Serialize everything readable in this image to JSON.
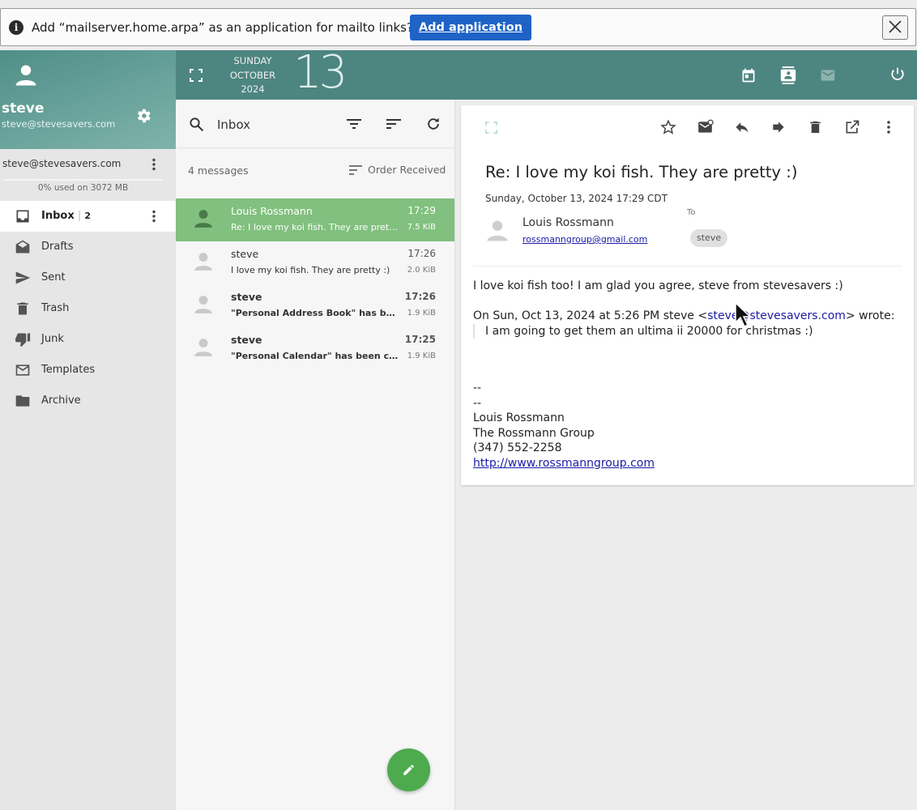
{
  "notification": {
    "message": "Add “mailserver.home.arpa” as an application for mailto links?",
    "add_button": "Add application"
  },
  "sidebar": {
    "user_name": "steve",
    "user_email": "steve@stevesavers.com",
    "account": "steve@stevesavers.com",
    "quota": "0% used on 3072 MB",
    "folders": [
      {
        "label": "Inbox",
        "count": "2",
        "icon": "inbox-icon"
      },
      {
        "label": "Drafts",
        "icon": "drafts-icon"
      },
      {
        "label": "Sent",
        "icon": "send-icon"
      },
      {
        "label": "Trash",
        "icon": "trash-icon"
      },
      {
        "label": "Junk",
        "icon": "thumbs-down-icon"
      },
      {
        "label": "Templates",
        "icon": "mail-icon"
      },
      {
        "label": "Archive",
        "icon": "folder-icon"
      }
    ]
  },
  "topbar": {
    "weekday": "SUNDAY",
    "month": "OCTOBER",
    "year": "2024",
    "day": "13"
  },
  "list": {
    "search_value": "Inbox",
    "message_count": "4 messages",
    "order_label": "Order Received",
    "messages": [
      {
        "from": "Louis Rossmann",
        "subject": "Re: I love my koi fish. They are pretty :)",
        "time": "17:29",
        "size": "7.5 KiB"
      },
      {
        "from": "steve",
        "subject": "I love my koi fish. They are pretty :)",
        "time": "17:26",
        "size": "2.0 KiB"
      },
      {
        "from": "steve",
        "subject": "\"Personal Address Book\" has been crea...",
        "time": "17:26",
        "size": "1.9 KiB"
      },
      {
        "from": "steve",
        "subject": "\"Personal Calendar\" has been created",
        "time": "17:25",
        "size": "1.9 KiB"
      }
    ]
  },
  "message": {
    "subject": "Re: I love my koi fish. They are pretty :)",
    "date": "Sunday, October 13, 2024 17:29 CDT",
    "from_name": "Louis Rossmann",
    "from_email": "rossmanngroup@gmail.com",
    "to_label": "To",
    "to_chip": "steve",
    "body": {
      "line1": "I love koi fish too! I am glad you agree, steve from stevesavers :)",
      "quote_prefix": "On Sun, Oct 13, 2024 at 5:26 PM steve <",
      "quote_email": "steve@stevesavers.com",
      "quote_suffix": "> wrote:",
      "quoted": "I am going to get them an ultima ii 20000 for christmas :)",
      "dash1": "--",
      "dash2": "--",
      "sig_name": "Louis Rossmann",
      "sig_company": "The Rossmann Group",
      "sig_phone": "(347) 552-2258",
      "sig_url": "http://www.rossmanngroup.com"
    }
  },
  "colors": {
    "accent": "#4d8580",
    "selected_row": "#81c07e",
    "fab": "#4dab4e",
    "notif_button": "#1f63c6"
  }
}
